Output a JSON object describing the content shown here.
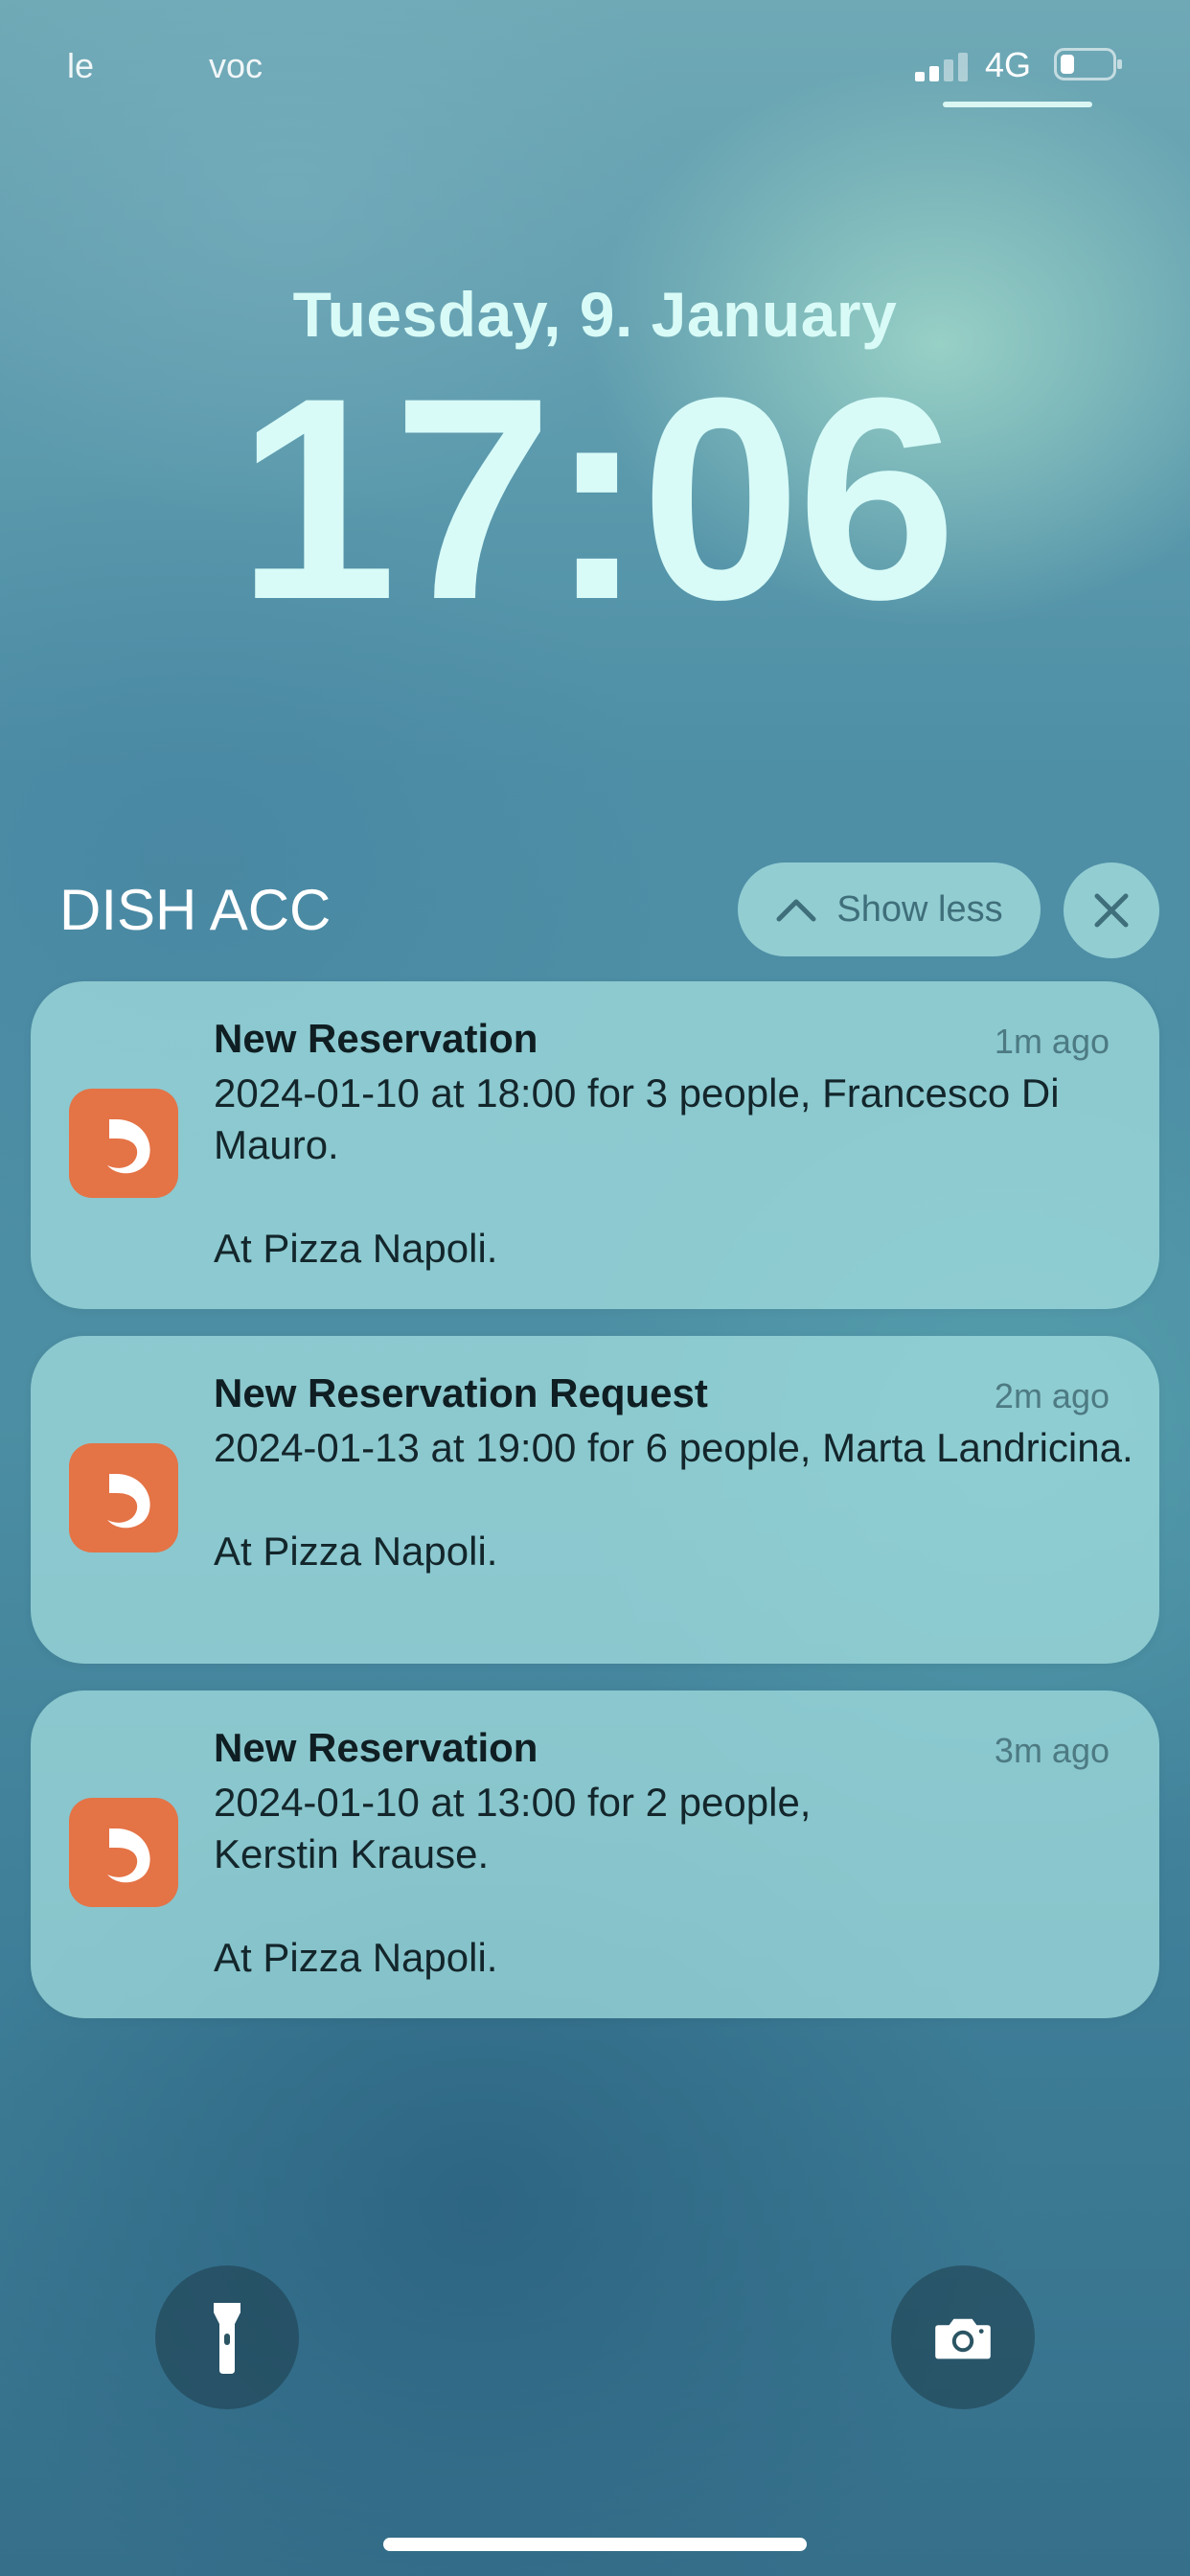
{
  "status_bar": {
    "carrier_left": "le",
    "carrier_right": "voc",
    "network": "4G"
  },
  "lock_screen": {
    "date": "Tuesday, 9. January",
    "time": "17:06"
  },
  "group": {
    "app_name": "DISH ACC",
    "show_less_label": "Show less"
  },
  "notifications": [
    {
      "title": "New Reservation",
      "time_ago": "1m ago",
      "body": "2024-01-10 at 18:00 for 3 people, Francesco Di Mauro.\n\nAt Pizza Napoli."
    },
    {
      "title": "New Reservation Request",
      "time_ago": "2m ago",
      "body": "2024-01-13 at 19:00 for 6 people, Marta Landricina.\n\nAt Pizza Napoli."
    },
    {
      "title": "New Reservation",
      "time_ago": "3m ago",
      "body": "2024-01-10 at 13:00 for 2 people,\nKerstin  Krause.\n\nAt Pizza Napoli."
    }
  ],
  "icons": {
    "app": "dish-logo-icon",
    "flashlight": "flashlight-icon",
    "camera": "camera-icon",
    "close": "close-icon",
    "chevron": "chevron-up-icon"
  },
  "colors": {
    "app_icon": "#e47346"
  }
}
